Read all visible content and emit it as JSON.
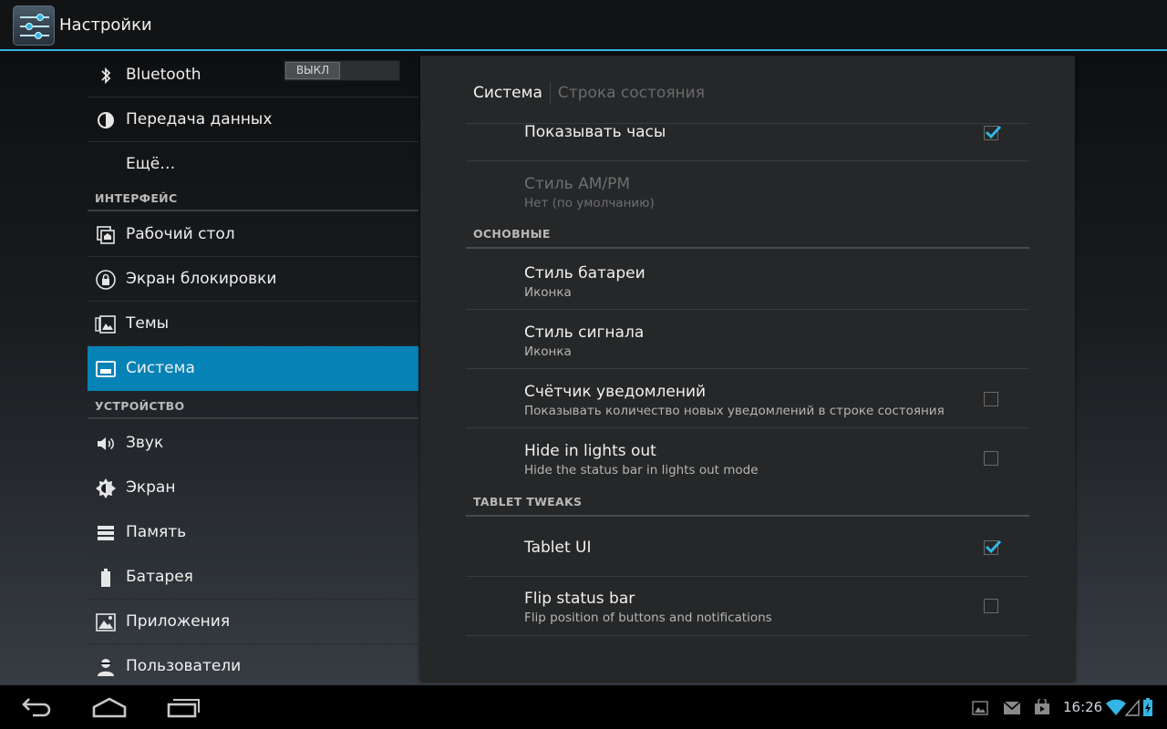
{
  "action_bar": {
    "title": "Настройки"
  },
  "left_list": {
    "bluetooth": {
      "label": "Bluetooth",
      "toggle_label": "ВЫКЛ"
    },
    "data_usage": {
      "label": "Передача данных"
    },
    "more": {
      "label": "Ещё…"
    },
    "interface_header": "ИНТЕРФЕЙС",
    "launcher": {
      "label": "Рабочий стол"
    },
    "lockscreen": {
      "label": "Экран блокировки"
    },
    "themes": {
      "label": "Темы"
    },
    "system": {
      "label": "Система"
    },
    "device_header": "УСТРОЙСТВО",
    "sound": {
      "label": "Звук"
    },
    "display": {
      "label": "Экран"
    },
    "storage": {
      "label": "Память"
    },
    "battery": {
      "label": "Батарея"
    },
    "apps": {
      "label": "Приложения"
    },
    "users": {
      "label": "Пользователи"
    }
  },
  "panel": {
    "breadcrumb_current": "Система",
    "breadcrumb_parent": "Строка состояния",
    "show_clock": {
      "title": "Показывать часы",
      "checked": true
    },
    "ampm_style": {
      "title": "Стиль AM/PM",
      "summary": "Нет (по умолчанию)"
    },
    "main_header": "ОСНОВНЫЕ",
    "battery_style": {
      "title": "Стиль батареи",
      "summary": "Иконка"
    },
    "signal_style": {
      "title": "Стиль сигнала",
      "summary": "Иконка"
    },
    "notif_count": {
      "title": "Счётчик уведомлений",
      "summary": "Показывать количество новых уведомлений в строке состояния",
      "checked": false
    },
    "hide_lights_out": {
      "title": "Hide in lights out",
      "summary": "Hide the status bar in lights out mode",
      "checked": false
    },
    "tablet_header": "TABLET TWEAKS",
    "tablet_ui": {
      "title": "Tablet UI",
      "checked": true
    },
    "flip_status_bar": {
      "title": "Flip status bar",
      "summary": "Flip position of buttons and notifications",
      "checked": false
    }
  },
  "nav_bar": {
    "clock": "16:26"
  },
  "colors": {
    "accent": "#33b5e5",
    "selected_row": "#0683b6",
    "panel_bg": "#262728"
  }
}
